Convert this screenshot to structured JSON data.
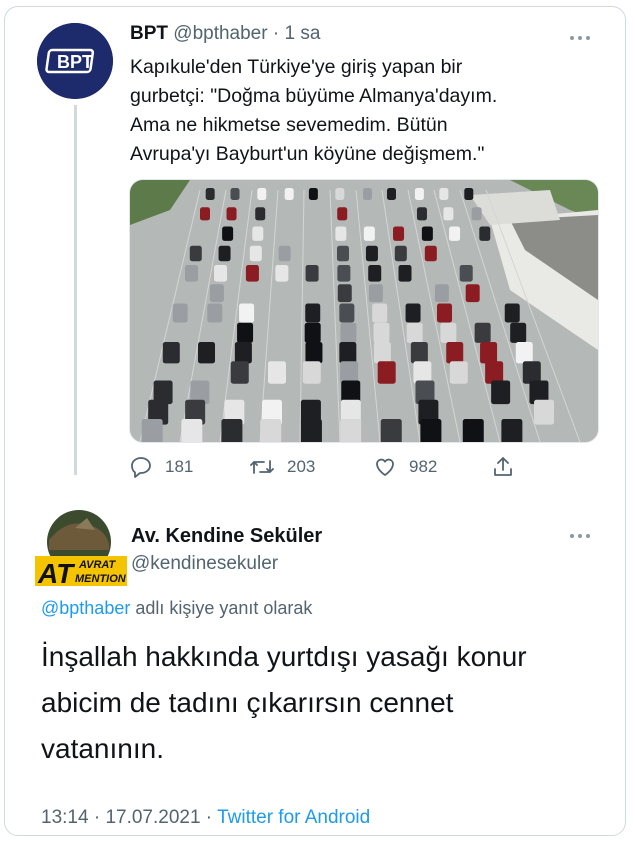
{
  "tweet": {
    "author_name": "BPT",
    "author_handle": "@bpthaber",
    "separator": "·",
    "time_ago": "1 sa",
    "avatar_icon": "bpt-logo",
    "avatar_text": "BPT",
    "text_lines": [
      "Kapıkule'den Türkiye'ye giriş yapan bir",
      "gurbetçi: \"Doğma büyüme Almanya'dayım.",
      "Ama ne hikmetse sevemedim. Bütün",
      "Avrupa'yı Bayburt'un köyüne değişmem.\""
    ],
    "stats": {
      "replies": "181",
      "retweets": "203",
      "likes": "982"
    },
    "icons": [
      "reply-icon",
      "retweet-icon",
      "like-icon",
      "share-icon",
      "more-icon"
    ]
  },
  "reply": {
    "author_name": "Av. Kendine Seküler",
    "author_handle": "@kendinesekuler",
    "avatar_badge_big": "AT",
    "avatar_badge_top": "AVRAT",
    "avatar_badge_bottom": "MENTION",
    "reply_to_handle": "@bpthaber",
    "reply_to_suffix": " adlı kişiye yanıt olarak",
    "text_lines": [
      "İnşallah hakkında yurtdışı yasağı konur",
      "abicim de tadını çıkarırsın cennet",
      "vatanının."
    ],
    "time": "13:14",
    "date": "17.07.2021",
    "meta_sep": " · ",
    "source": "Twitter for Android"
  },
  "colors": {
    "accent": "#1d9bf0",
    "muted": "#536471",
    "border": "#cfd9de",
    "avatar_bg": "#1d2a6b",
    "badge_yellow": "#f5c400"
  }
}
